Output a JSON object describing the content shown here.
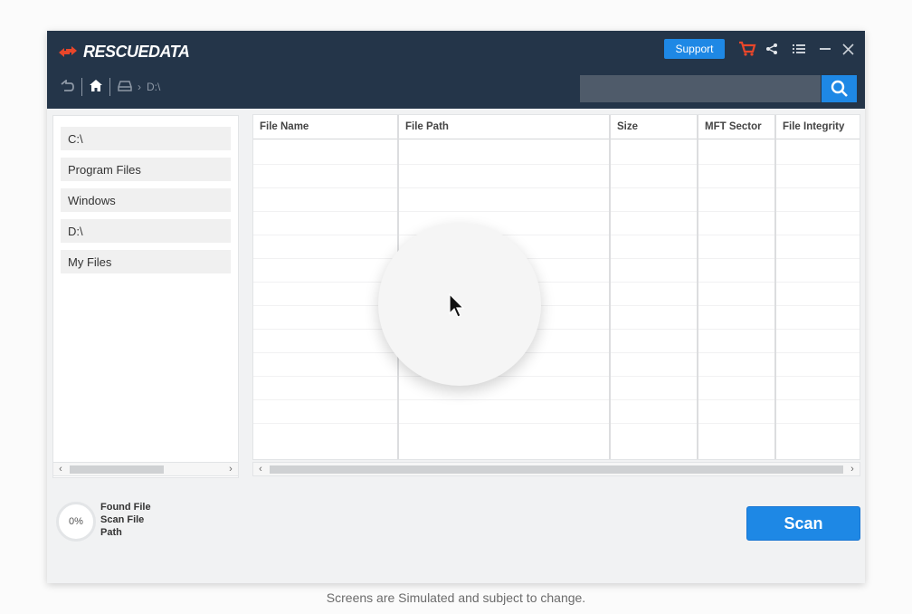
{
  "app": {
    "logo_text": "RESCUEDATA"
  },
  "header": {
    "support_label": "Support",
    "icons": [
      "cart-icon",
      "share-icon",
      "menu-icon",
      "minimize-icon",
      "close-icon"
    ],
    "breadcrumb": {
      "drive_icon": "drive-icon",
      "path": "D:\\"
    },
    "search_placeholder": ""
  },
  "sidebar": {
    "items": [
      {
        "label": "C:\\"
      },
      {
        "label": "Program Files"
      },
      {
        "label": "Windows"
      },
      {
        "label": "D:\\"
      },
      {
        "label": "My Files"
      }
    ]
  },
  "table": {
    "columns": [
      "File Name",
      "File Path",
      "Size",
      "MFT Sector",
      "File Integrity"
    ],
    "rows": []
  },
  "status": {
    "progress_text": "0%",
    "progress_value": 0,
    "lines": [
      "Found File",
      "Scan File",
      "Path"
    ]
  },
  "actions": {
    "scan_label": "Scan"
  },
  "caption": "Screens are Simulated and subject to change.",
  "colors": {
    "titlebar": "#243549",
    "accent": "#1e88e5",
    "logo_orange": "#e8462a",
    "cart": "#e8462a"
  }
}
